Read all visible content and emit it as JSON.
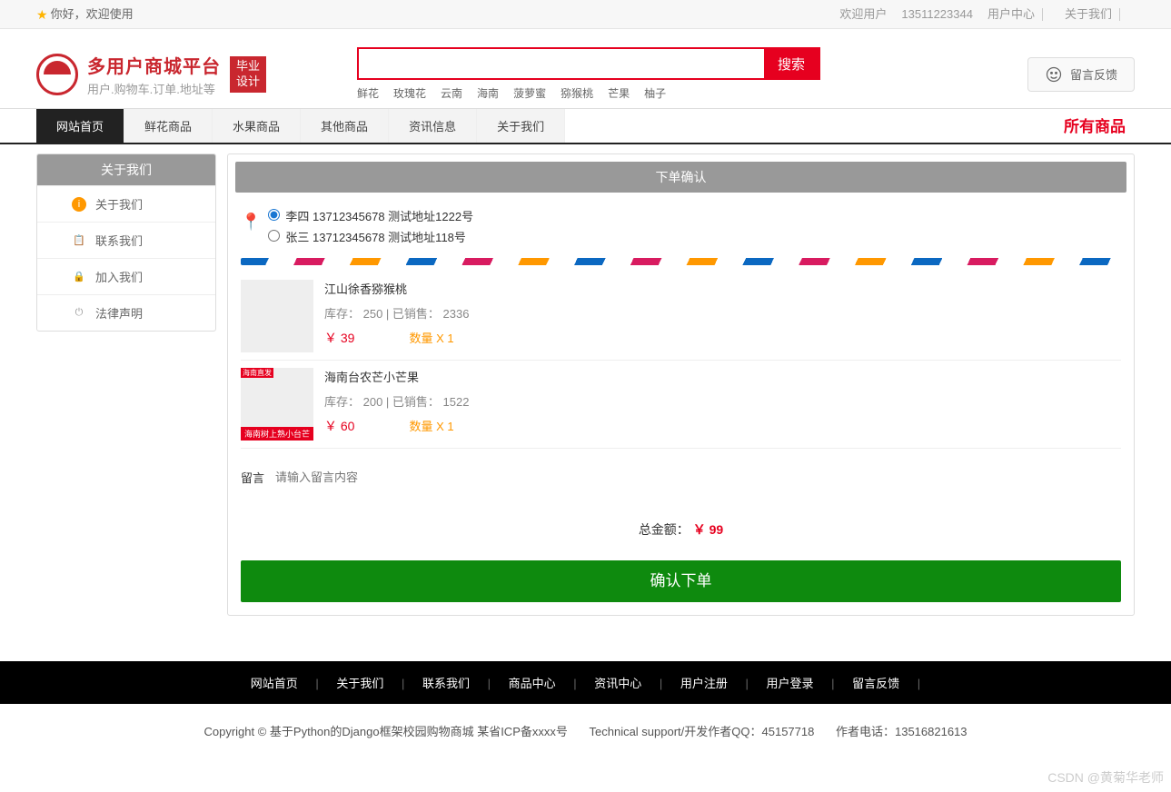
{
  "topbar": {
    "welcome": "你好，欢迎使用",
    "welcome_user": "欢迎用户",
    "phone": "13511223344",
    "user_center": "用户中心",
    "about": "关于我们"
  },
  "logo": {
    "title": "多用户商城平台",
    "subtitle": "用户.购物车.订单.地址等",
    "tag1": "毕业",
    "tag2": "设计"
  },
  "search": {
    "placeholder": "",
    "button": "搜索",
    "hot": [
      "鲜花",
      "玫瑰花",
      "云南",
      "海南",
      "菠萝蜜",
      "猕猴桃",
      "芒果",
      "柚子"
    ]
  },
  "msg_button": "留言反馈",
  "nav": {
    "items": [
      "网站首页",
      "鲜花商品",
      "水果商品",
      "其他商品",
      "资讯信息",
      "关于我们"
    ],
    "all": "所有商品"
  },
  "sidebar": {
    "title": "关于我们",
    "items": [
      "关于我们",
      "联系我们",
      "加入我们",
      "法律声明"
    ]
  },
  "order": {
    "title": "下单确认",
    "addresses": [
      "李四 13712345678 测试地址1222号",
      "张三 13712345678 测试地址118号"
    ],
    "products": [
      {
        "name": "江山徐香猕猴桃",
        "stock_label": "库存：",
        "stock": "250",
        "sold_label": "已销售：",
        "sold": "2336",
        "price": "￥ 39",
        "qty": "数量 X 1",
        "img_class": "kiwi"
      },
      {
        "name": "海南台农芒小芒果",
        "stock_label": "库存：",
        "stock": "200",
        "sold_label": "已销售：",
        "sold": "1522",
        "price": "￥ 60",
        "qty": "数量 X 1",
        "img_class": "mango"
      }
    ],
    "remark_label": "留言",
    "remark_placeholder": "请输入留言内容",
    "total_label": "总金额：",
    "total_amount": "￥ 99",
    "confirm": "确认下单"
  },
  "footer": {
    "links": [
      "网站首页",
      "关于我们",
      "联系我们",
      "商品中心",
      "资讯中心",
      "用户注册",
      "用户登录",
      "留言反馈"
    ],
    "copyright1": "Copyright © 基于Python的Django框架校园购物商城 某省ICP备xxxx号",
    "copyright2": "Technical support/开发作者QQ：45157718",
    "copyright3": "作者电话：13516821613"
  },
  "watermark": "CSDN @黄菊华老师"
}
